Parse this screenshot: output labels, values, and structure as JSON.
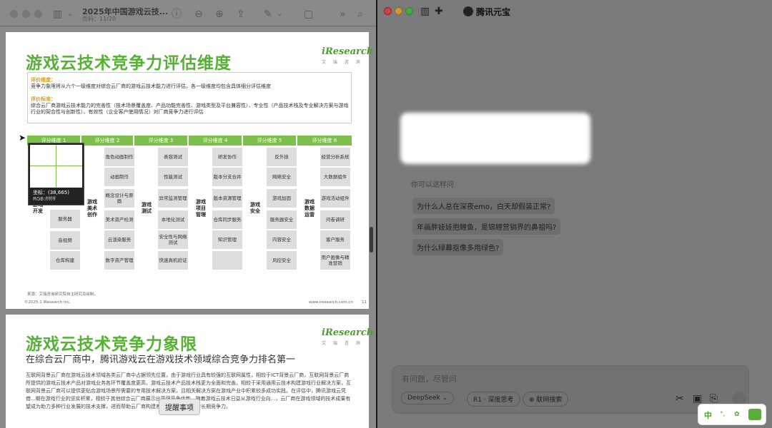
{
  "left_window": {
    "doc_title": "2025年中国游戏云技...",
    "page_indicator": "页码：11/20"
  },
  "page1": {
    "title": "游戏云技术竞争力评估维度",
    "logo": "iResearch",
    "logo_sub": "艾 瑞 咨 询",
    "dim_label": "评价维度：",
    "dim_text": "竞争力象限将从六个一级维度对综合云厂商的游戏云技术能力进行评估，各一级维度均包含具体细分评估维度",
    "std_label": "评价标准：",
    "std_text": "综合云厂商游戏云技术能力的完善性（技术场景覆盖度、产品功能完善性、游戏类型及平台兼容性）、专业性（产品技术栈及专业解决方案与游戏行业的契合性与创新性）、有效性（企业客户使用情况）对厂商竞争力进行评估",
    "headers": [
      "评分维度 1",
      "评分维度 2",
      "评分维度 3",
      "评分维度 4",
      "评分维度 5",
      "评分维度 6"
    ],
    "cat1": "游戏开发",
    "cat2": "游戏美术创作",
    "cat3": "游戏测试",
    "cat4": "游戏项目管理",
    "cat5": "游戏安全",
    "cat6": "游戏数据运营",
    "col1": [
      "服务器",
      "音视频",
      "仓库构建"
    ],
    "col2": [
      "角色动画制作",
      "动画制作",
      "概念设计与原画",
      "美术资产检测",
      "云渲染服务",
      "数字资产管理"
    ],
    "col3": [
      "表容测试",
      "性能测试",
      "异常监测管理",
      "本地化测试",
      "安全性与网络测试",
      "快速真机验证"
    ],
    "col4": [
      "研发协作",
      "版本分支合并",
      "版本资源管理",
      "仓库同步服务",
      "知识管理"
    ],
    "col5": [
      "反外挂",
      "网络安全",
      "游戏加固",
      "服务器安全",
      "内容安全",
      "风控安全"
    ],
    "col6": [
      "经营分析系统",
      "大数据组件",
      "游戏活动组件",
      "问卷调研",
      "客户服务",
      "用户画像与精准营销"
    ],
    "tooltip_coord": "坐标：(38,665)",
    "tooltip_rgb": "RGB:ffffff",
    "source": "来源：艾瑞咨询研究院自主研究及绘制。",
    "copyright": "©2025.1 iResearch Inc.",
    "site": "www.iresearch.com.cn",
    "page_num": "11"
  },
  "page2": {
    "title": "游戏云技术竞争力象限",
    "logo": "iResearch",
    "logo_sub": "艾 瑞 咨 询",
    "subtitle": "在综合云厂商中，腾讯游戏云在游戏技术领域综合竞争力排名第一",
    "body": "互联网背景云厂商在游戏云技术领域各类云厂商中占据领先位置，由于游戏行业具有较强的互联网属性，相较于ICT背景云厂商，互联网背景云厂商所提供的游戏云技术产品对游戏业务各环节覆盖度更高，游戏云技术产品技术栈更为全面和完善。相较于采用通用云技术构建游戏行业解决方案，互联网背景云厂商可以提供更贴合游戏场景所需要的专用技术解决方案，且相关解决方案在游戏产业中积累较多成功实践。在评估中，腾讯游戏云凭借...期在游戏行业的坚实积累，相较于其他综合云厂商展示出更强竞争优势，随着游戏云技术日益从游戏行业向...，云厂商在游戏领域的技术成果有望成为助力多种行业发展的技术支撑，进而帮助云厂商构建差异化竞争力，保持长期竞争力。",
    "reminder": "提醒事项"
  },
  "right_window": {
    "app_name": "腾讯元宝",
    "hint": "你可以这样问",
    "suggestions": [
      "为什么人总在深夜emo，白天却假装正常?",
      "年画胖娃娃抱鲤鱼，是锦鲤营销界的鼻祖吗?",
      "为什么绿幕抠像多用绿色?"
    ],
    "input_placeholder": "有问题，尽管问",
    "btn_deepseek": "DeepSeek",
    "btn_r1": "R1 · 深度思考",
    "btn_web": "联网搜索",
    "ime": "中"
  }
}
